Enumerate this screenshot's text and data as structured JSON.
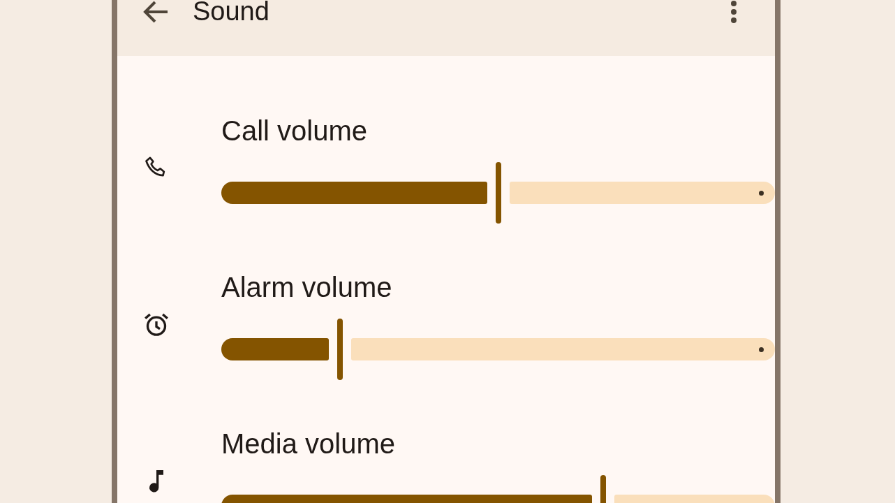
{
  "header": {
    "title": "Sound"
  },
  "volumes": [
    {
      "label": "Call volume",
      "kind": "phone",
      "level": 0.5
    },
    {
      "label": "Alarm volume",
      "kind": "alarm",
      "level": 0.215
    },
    {
      "label": "Media volume",
      "kind": "music",
      "level": 0.69
    }
  ]
}
